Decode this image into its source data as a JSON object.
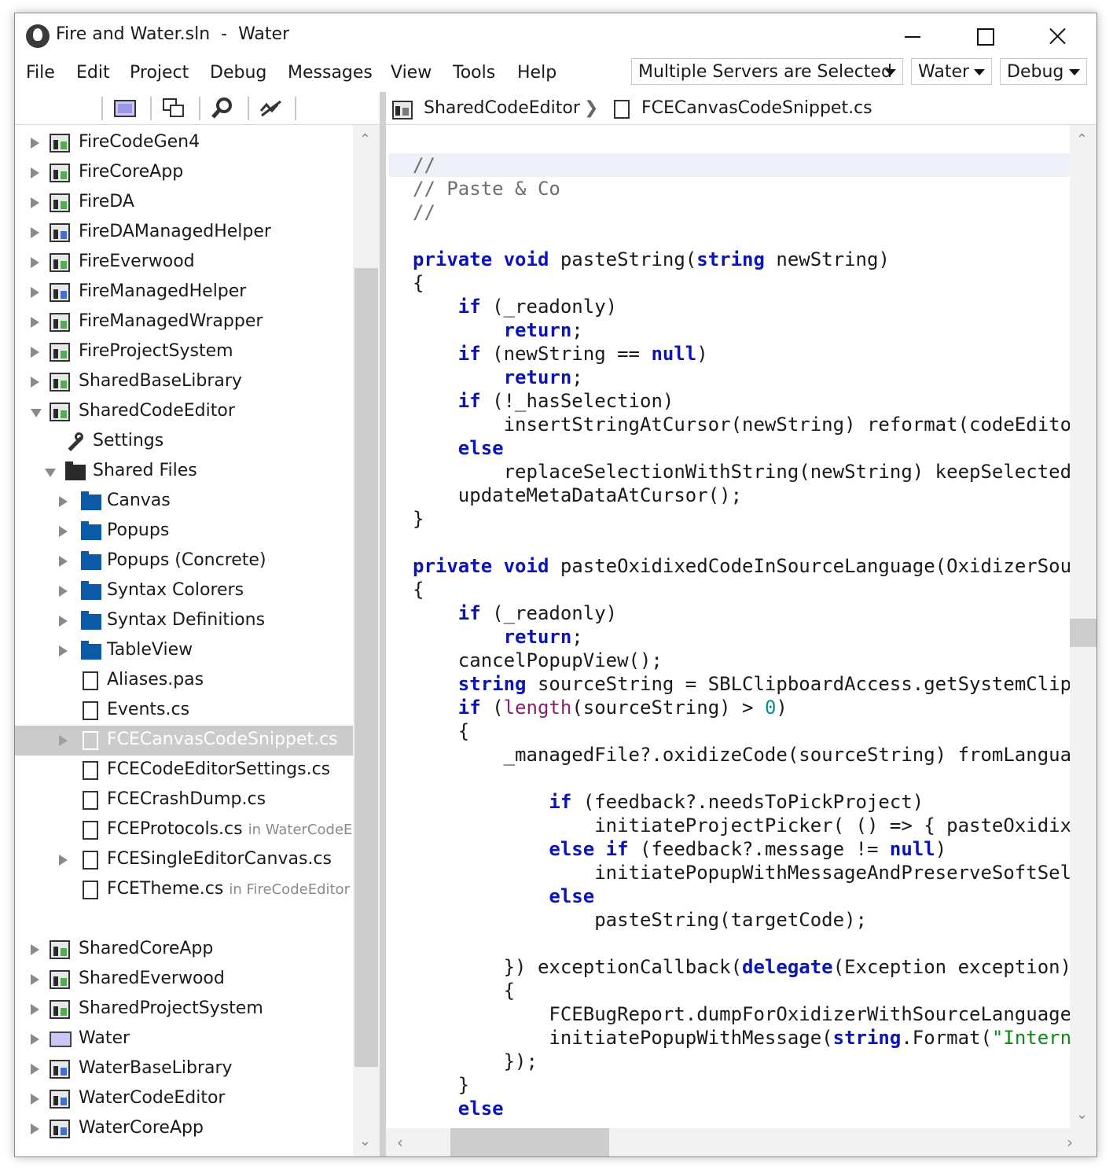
{
  "window": {
    "title": "Fire and Water.sln  -  Water",
    "menu": [
      "File",
      "Edit",
      "Project",
      "Debug",
      "Messages",
      "View",
      "Tools",
      "Help"
    ],
    "dropdowns": {
      "servers": "Multiple Servers are Selected",
      "target": "Water",
      "config": "Debug"
    }
  },
  "breadcrumb": {
    "project": "SharedCodeEditor",
    "separator": "❯",
    "file": "FCECanvasCodeSnippet.cs"
  },
  "tree": {
    "items": [
      {
        "label": "FireCodeGen4",
        "icon": "project-icon"
      },
      {
        "label": "FireCoreApp",
        "icon": "project-icon"
      },
      {
        "label": "FireDA",
        "icon": "project-icon"
      },
      {
        "label": "FireDAManagedHelper",
        "icon": "project-icon"
      },
      {
        "label": "FireEverwood",
        "icon": "project-icon"
      },
      {
        "label": "FireManagedHelper",
        "icon": "project-icon"
      },
      {
        "label": "FireManagedWrapper",
        "icon": "project-icon"
      },
      {
        "label": "FireProjectSystem",
        "icon": "project-icon"
      },
      {
        "label": "SharedBaseLibrary",
        "icon": "project-icon"
      },
      {
        "label": "SharedCodeEditor",
        "icon": "project-icon"
      },
      {
        "label": "Settings",
        "icon": "wrench-icon"
      },
      {
        "label": "Shared Files",
        "icon": "open-folder-icon"
      },
      {
        "label": "Canvas",
        "icon": "folder-icon"
      },
      {
        "label": "Popups",
        "icon": "folder-icon"
      },
      {
        "label": "Popups (Concrete)",
        "icon": "folder-icon"
      },
      {
        "label": "Syntax Colorers",
        "icon": "folder-icon"
      },
      {
        "label": "Syntax Definitions",
        "icon": "folder-icon"
      },
      {
        "label": "TableView",
        "icon": "folder-icon"
      },
      {
        "label": "Aliases.pas",
        "icon": "file-icon"
      },
      {
        "label": "Events.cs",
        "icon": "file-icon"
      },
      {
        "label": "FCECanvasCodeSnippet.cs",
        "icon": "file-icon"
      },
      {
        "label": "FCECodeEditorSettings.cs",
        "icon": "file-icon"
      },
      {
        "label": "FCECrashDump.cs",
        "icon": "file-icon"
      },
      {
        "label": "FCEProtocols.cs",
        "hint": "in WaterCodeEd",
        "icon": "file-icon"
      },
      {
        "label": "FCESingleEditorCanvas.cs",
        "icon": "file-icon"
      },
      {
        "label": "FCETheme.cs",
        "hint": "in FireCodeEditor",
        "icon": "file-icon"
      },
      {
        "label": "SharedCoreApp",
        "icon": "project-icon"
      },
      {
        "label": "SharedEverwood",
        "icon": "project-icon"
      },
      {
        "label": "SharedProjectSystem",
        "icon": "project-icon"
      },
      {
        "label": "Water",
        "icon": "water-project-icon"
      },
      {
        "label": "WaterBaseLibrary",
        "icon": "project-icon"
      },
      {
        "label": "WaterCodeEditor",
        "icon": "project-icon"
      },
      {
        "label": "WaterCoreApp",
        "icon": "project-icon"
      }
    ]
  },
  "colors": {
    "keyword": "#0a14b8",
    "comment": "#6e6e6e",
    "builtin_function": "#8a1f6e",
    "number": "#0f8a8a",
    "string": "#0e8a14",
    "selection": "#cbcbcb"
  },
  "code": {
    "lines": [
      [
        {
          "t": "//",
          "c": "cm"
        }
      ],
      [
        {
          "t": "// Paste & Co",
          "c": "cm"
        }
      ],
      [
        {
          "t": "//",
          "c": "cm"
        }
      ],
      [],
      [
        {
          "t": "private",
          "c": "kw"
        },
        {
          "t": " "
        },
        {
          "t": "void",
          "c": "kw"
        },
        {
          "t": " pasteString("
        },
        {
          "t": "string",
          "c": "kw"
        },
        {
          "t": " newString)"
        }
      ],
      [
        {
          "t": "{"
        }
      ],
      [
        {
          "t": "    "
        },
        {
          "t": "if",
          "c": "kw"
        },
        {
          "t": " (_readonly)"
        }
      ],
      [
        {
          "t": "        "
        },
        {
          "t": "return",
          "c": "kw"
        },
        {
          "t": ";"
        }
      ],
      [
        {
          "t": "    "
        },
        {
          "t": "if",
          "c": "kw"
        },
        {
          "t": " (newString == "
        },
        {
          "t": "null",
          "c": "kw"
        },
        {
          "t": ")"
        }
      ],
      [
        {
          "t": "        "
        },
        {
          "t": "return",
          "c": "kw"
        },
        {
          "t": ";"
        }
      ],
      [
        {
          "t": "    "
        },
        {
          "t": "if",
          "c": "kw"
        },
        {
          "t": " (!_hasSelection)"
        }
      ],
      [
        {
          "t": "        insertStringAtCursor(newString) reformat(codeEditor"
        }
      ],
      [
        {
          "t": "    "
        },
        {
          "t": "else",
          "c": "kw"
        }
      ],
      [
        {
          "t": "        replaceSelectionWithString(newString) keepSelected("
        }
      ],
      [
        {
          "t": "    updateMetaDataAtCursor();"
        }
      ],
      [
        {
          "t": "}"
        }
      ],
      [],
      [
        {
          "t": "private",
          "c": "kw"
        },
        {
          "t": " "
        },
        {
          "t": "void",
          "c": "kw"
        },
        {
          "t": " pasteOxidixedCodeInSourceLanguage(OxidizerSour"
        }
      ],
      [
        {
          "t": "{"
        }
      ],
      [
        {
          "t": "    "
        },
        {
          "t": "if",
          "c": "kw"
        },
        {
          "t": " (_readonly)"
        }
      ],
      [
        {
          "t": "        "
        },
        {
          "t": "return",
          "c": "kw"
        },
        {
          "t": ";"
        }
      ],
      [
        {
          "t": "    cancelPopupView();"
        }
      ],
      [
        {
          "t": "    "
        },
        {
          "t": "string",
          "c": "kw"
        },
        {
          "t": " sourceString = SBLClipboardAccess.getSystemClipb"
        }
      ],
      [
        {
          "t": "    "
        },
        {
          "t": "if",
          "c": "kw"
        },
        {
          "t": " ("
        },
        {
          "t": "length",
          "c": "fn"
        },
        {
          "t": "(sourceString) > "
        },
        {
          "t": "0",
          "c": "num"
        },
        {
          "t": ")"
        }
      ],
      [
        {
          "t": "    {"
        }
      ],
      [
        {
          "t": "        _managedFile?.oxidizeCode(sourceString) fromLanguag"
        }
      ],
      [],
      [
        {
          "t": "            "
        },
        {
          "t": "if",
          "c": "kw"
        },
        {
          "t": " (feedback?.needsToPickProject)"
        }
      ],
      [
        {
          "t": "                initiateProjectPicker( () => { pasteOxidixe"
        }
      ],
      [
        {
          "t": "            "
        },
        {
          "t": "else",
          "c": "kw"
        },
        {
          "t": " "
        },
        {
          "t": "if",
          "c": "kw"
        },
        {
          "t": " (feedback?.message != "
        },
        {
          "t": "null",
          "c": "kw"
        },
        {
          "t": ")"
        }
      ],
      [
        {
          "t": "                initiatePopupWithMessageAndPreserveSoftSele"
        }
      ],
      [
        {
          "t": "            "
        },
        {
          "t": "else",
          "c": "kw"
        }
      ],
      [
        {
          "t": "                pasteString(targetCode);"
        }
      ],
      [],
      [
        {
          "t": "        }) exceptionCallback("
        },
        {
          "t": "delegate",
          "c": "kw"
        },
        {
          "t": "(Exception exception)"
        }
      ],
      [
        {
          "t": "        {"
        }
      ],
      [
        {
          "t": "            FCEBugReport.dumpForOxidizerWithSourceLanguage("
        }
      ],
      [
        {
          "t": "            initiatePopupWithMessage("
        },
        {
          "t": "string",
          "c": "kw"
        },
        {
          "t": ".Format("
        },
        {
          "t": "\"Interna",
          "c": "str"
        }
      ],
      [
        {
          "t": "        });"
        }
      ],
      [
        {
          "t": "    }"
        }
      ],
      [
        {
          "t": "    "
        },
        {
          "t": "else",
          "c": "kw"
        }
      ]
    ]
  }
}
